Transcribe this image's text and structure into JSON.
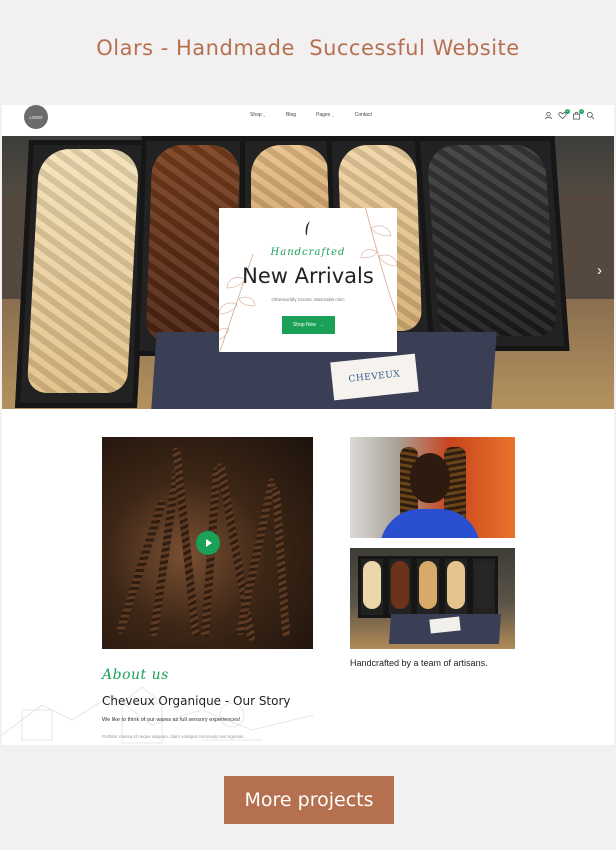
{
  "showcase": {
    "title": "Olars - Handmade  Successful Website",
    "more_button": "More projects"
  },
  "colors": {
    "accent": "#b5714f",
    "brand_green": "#1aa157"
  },
  "header": {
    "logo_text": "LOGO",
    "nav": [
      {
        "label": "Shop",
        "has_dropdown": true
      },
      {
        "label": "Blog",
        "has_dropdown": false
      },
      {
        "label": "Pages",
        "has_dropdown": true
      },
      {
        "label": "Contact",
        "has_dropdown": false
      }
    ],
    "icons": [
      "user-icon",
      "heart-icon",
      "cart-icon",
      "search-icon"
    ],
    "wishlist_count": "0",
    "cart_count": "0"
  },
  "hero": {
    "script": "Handcrafted",
    "heading": "New Arrivals",
    "subtext": "Otherworldly Scents. Minimalist chic!",
    "cta": "Shop Now",
    "cta_arrow": "→",
    "box_label": "CHEVEUX",
    "next_arrow": "›"
  },
  "content": {
    "caption": "Handcrafted by a team of artisans.",
    "about_script": "About us",
    "story_title": "Cheveux Organique - Our Story",
    "story_lead": "We like to think of our wares as full sensory experiences!",
    "story_body": "Porttitor massa id neque aliquam, diam volutpat commodo sed egestas"
  }
}
